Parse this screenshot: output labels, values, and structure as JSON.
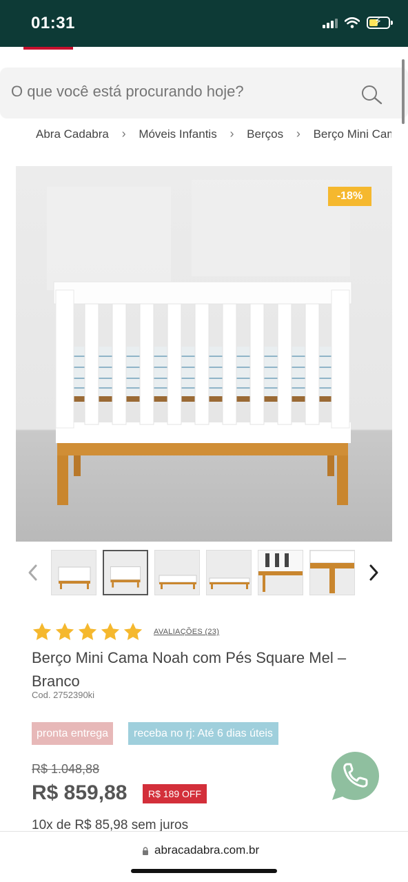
{
  "status_bar": {
    "time": "01:31"
  },
  "search": {
    "placeholder": "O que você está procurando hoje?"
  },
  "breadcrumb": {
    "items": [
      "Abra Cadabra",
      "Móveis Infantis",
      "Berços",
      "Berço Mini Cama Noah com Pés Square Mel – Branco"
    ],
    "separator": ">"
  },
  "product": {
    "discount_badge": "-18%",
    "rating": {
      "stars": 5,
      "reviews_label": "AVALIAÇÕES (23)"
    },
    "title": "Berço Mini Cama Noah com Pés Square Mel – Branco",
    "code": "Cod. 2752390ki",
    "tags": {
      "ready": "pronta entrega",
      "delivery": "receba no rj: Até 6 dias úteis"
    },
    "old_price": "R$ 1.048,88",
    "price": "R$ 859,88",
    "off_badge": "R$ 189 OFF",
    "installments": "10x de R$ 85,98 sem juros"
  },
  "thumbnails": {
    "count": 6,
    "active_index": 1
  },
  "browser": {
    "url": "abracadabra.com.br"
  },
  "colors": {
    "status_bar": "#0d3a36",
    "accent": "#c8102e",
    "star": "#f5b82e",
    "discount_badge": "#f5b82e",
    "off_badge": "#d32f3a",
    "whatsapp": "#8fbf9f"
  }
}
